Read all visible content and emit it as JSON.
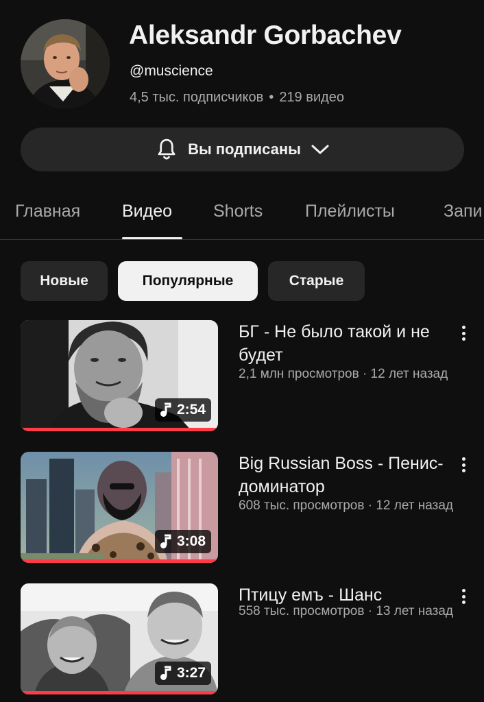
{
  "channel": {
    "name": "Aleksandr Gorbachev",
    "handle": "@muscience",
    "subscribers": "4,5 тыс. подписчиков",
    "separator": "•",
    "video_count": "219 видео"
  },
  "subscribe_button": {
    "label": "Вы подписаны",
    "icon": "bell-icon",
    "dropdown_icon": "chevron-down-icon"
  },
  "tabs": [
    {
      "label": "Главная"
    },
    {
      "label": "Видео"
    },
    {
      "label": "Shorts"
    },
    {
      "label": "Плейлисты"
    },
    {
      "label": "Запи"
    }
  ],
  "active_tab": "Видео",
  "filters": [
    {
      "label": "Новые"
    },
    {
      "label": "Популярные"
    },
    {
      "label": "Старые"
    }
  ],
  "active_filter": "Популярные",
  "videos": [
    {
      "title": "БГ - Не было такой и не будет",
      "meta": "2,1 млн просмотров · 12 лет назад",
      "duration": "2:54",
      "watched_fraction": 1.0
    },
    {
      "title": "Big Russian Boss - Пенис-доминатор",
      "meta": "608 тыс. просмотров · 12 лет назад",
      "duration": "3:08",
      "watched_fraction": 1.0
    },
    {
      "title": "Птицу емъ - Шанс",
      "meta": "558 тыс. просмотров · 13 лет назад",
      "duration": "3:27",
      "watched_fraction": 1.0
    }
  ],
  "colors": {
    "background": "#0f0f0f",
    "surface": "#272727",
    "text_primary": "#f1f1f1",
    "text_secondary": "#aaaaaa",
    "progress": "#ff3b45"
  }
}
